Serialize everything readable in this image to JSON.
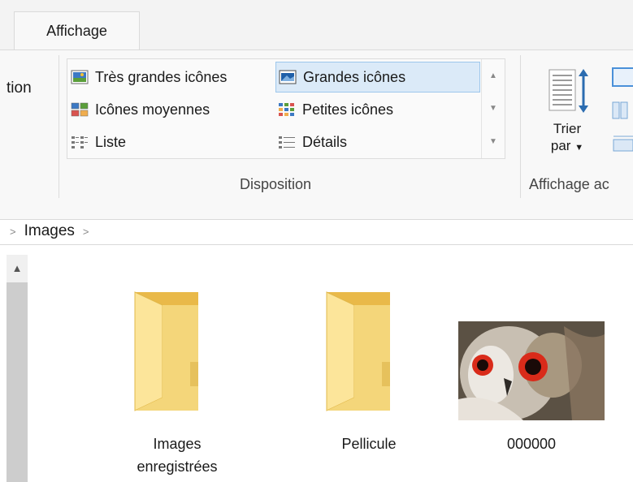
{
  "ribbon": {
    "active_tab": "Affichage",
    "left_partial": "tion",
    "gallery": [
      {
        "label": "Très grandes icônes",
        "icon": "extra-large-icons-icon",
        "selected": false
      },
      {
        "label": "Grandes icônes",
        "icon": "large-icons-icon",
        "selected": true
      },
      {
        "label": "Icônes moyennes",
        "icon": "medium-icons-icon",
        "selected": false
      },
      {
        "label": "Petites icônes",
        "icon": "small-icons-icon",
        "selected": false
      },
      {
        "label": "Liste",
        "icon": "list-icon",
        "selected": false
      },
      {
        "label": "Détails",
        "icon": "details-icon",
        "selected": false
      }
    ],
    "group_disposition": "Disposition",
    "sort_label_line1": "Trier",
    "sort_label_line2": "par",
    "group_current_view": "Affichage ac"
  },
  "address": {
    "breadcrumb": [
      "Images"
    ]
  },
  "items": [
    {
      "name_line1": "Images",
      "name_line2": "enregistrées",
      "type": "folder"
    },
    {
      "name_line1": "Pellicule",
      "name_line2": "",
      "type": "folder"
    },
    {
      "name_line1": "000000",
      "name_line2": "",
      "type": "image-owl"
    }
  ],
  "colors": {
    "selection": "#dbeaf8",
    "selection_border": "#9dc7ec",
    "folder": "#f4d67a"
  }
}
